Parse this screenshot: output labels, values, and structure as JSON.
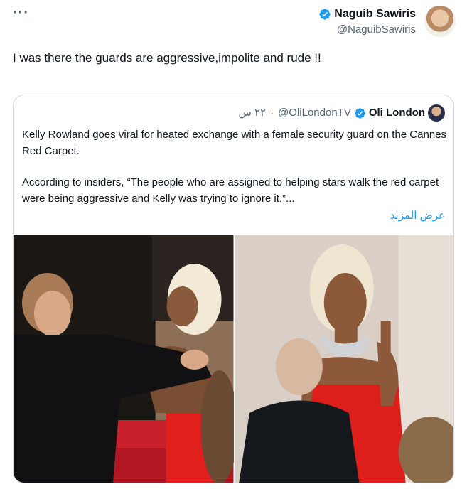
{
  "tweet": {
    "author_name": "Naguib Sawiris",
    "author_handle": "@NaguibSawiris",
    "text": "I was there the guards are aggressive,impolite and rude !!",
    "more_label": "···"
  },
  "quote": {
    "author_name": "Oli London",
    "author_handle": "@OliLondonTV",
    "separator": "·",
    "time": "٢٢ س",
    "paragraph_1": "Kelly Rowland goes viral for heated exchange with a female security guard on the Cannes Red Carpet.",
    "paragraph_2": "According to insiders, “The people who are assigned to helping stars walk the red carpet were being aggressive and Kelly was trying to ignore it.”...",
    "show_more": "عرض المزيد"
  },
  "icons": {
    "more": "more-horizontal-icon",
    "verified": "verified-badge-icon"
  },
  "colors": {
    "accent": "#1d9bf0",
    "secondary_text": "#536471",
    "border": "#cfd9de",
    "red_dress": "#e0201c"
  }
}
